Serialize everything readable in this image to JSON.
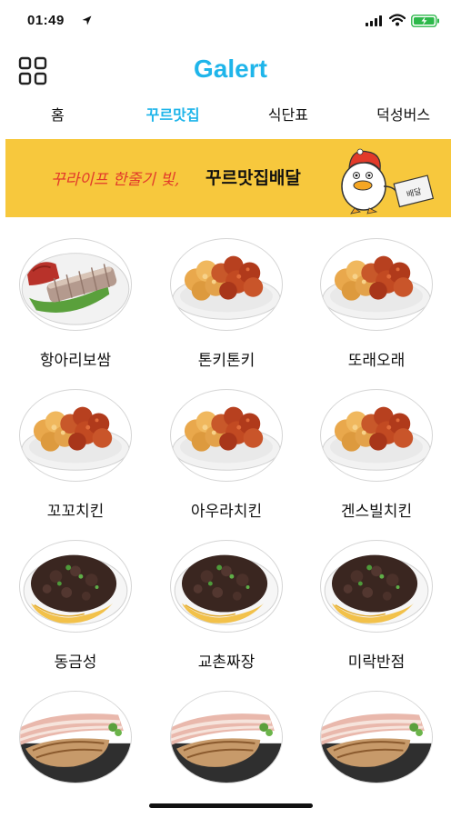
{
  "status": {
    "time": "01:49"
  },
  "header": {
    "title": "Galert"
  },
  "tabs": [
    {
      "label": "홈"
    },
    {
      "label": "꾸르맛집"
    },
    {
      "label": "식단표"
    },
    {
      "label": "덕성버스"
    }
  ],
  "banner": {
    "slogan": "꾸라이프 한줄기 빛,",
    "service": "꾸르맛집배달",
    "sign_text": "배달"
  },
  "restaurants": [
    {
      "name": "항아리보쌈",
      "food": "bossam"
    },
    {
      "name": "톤키톤키",
      "food": "chicken"
    },
    {
      "name": "또래오래",
      "food": "chicken"
    },
    {
      "name": "꼬꼬치킨",
      "food": "chicken"
    },
    {
      "name": "아우라치킨",
      "food": "chicken"
    },
    {
      "name": "겐스빌치킨",
      "food": "chicken"
    },
    {
      "name": "동금성",
      "food": "jjajang"
    },
    {
      "name": "교촌짜장",
      "food": "jjajang"
    },
    {
      "name": "미락반점",
      "food": "jjajang"
    },
    {
      "name": "",
      "food": "pork"
    },
    {
      "name": "",
      "food": "pork"
    },
    {
      "name": "",
      "food": "pork"
    }
  ],
  "colors": {
    "accent": "#1fb5ea",
    "banner": "#f7c83d",
    "slogan": "#e23a2a"
  }
}
